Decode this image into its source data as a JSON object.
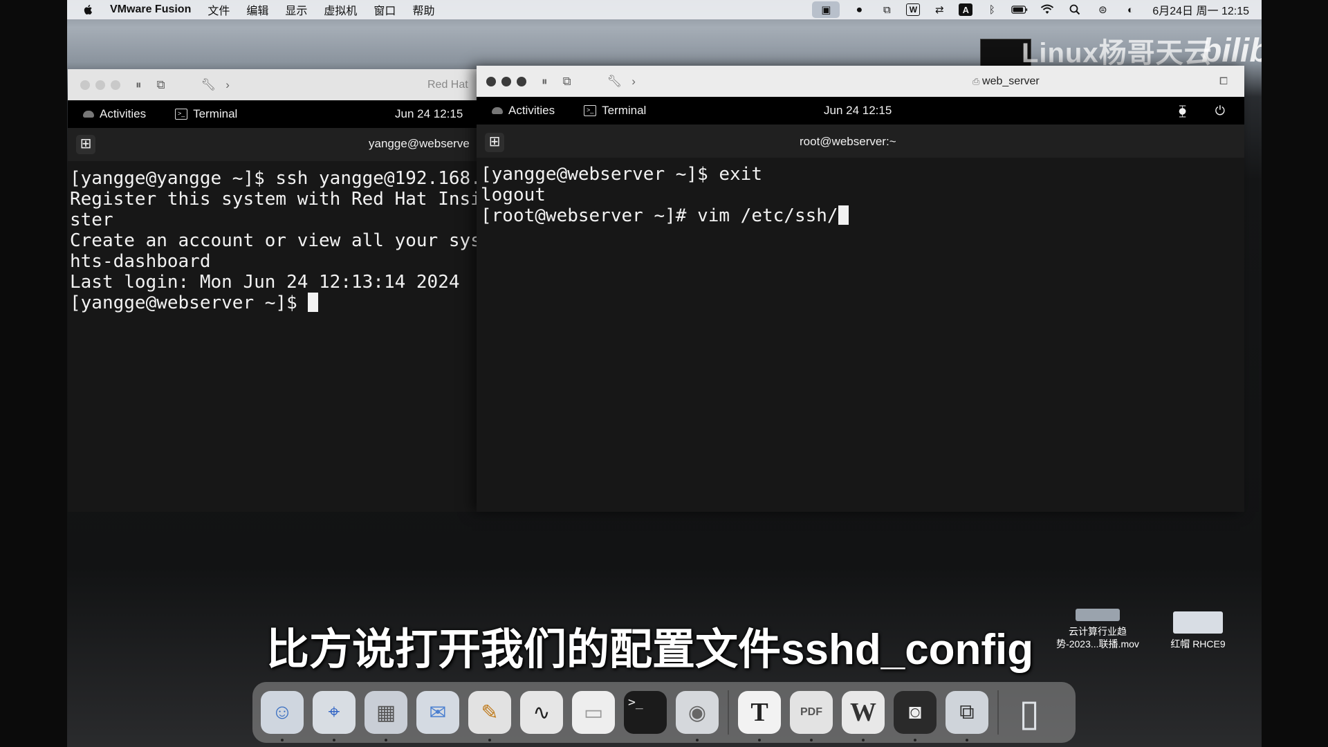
{
  "menubar": {
    "app_name": "VMware Fusion",
    "items": [
      "文件",
      "编辑",
      "显示",
      "虚拟机",
      "窗口",
      "帮助"
    ],
    "status_icons": [
      "vm-icon",
      "camera-icon",
      "screen-icon",
      "wps-icon",
      "sync-icon",
      "input-a-icon",
      "bluetooth-icon",
      "battery-icon",
      "wifi-icon",
      "search-icon",
      "control-center-icon",
      "siri-icon"
    ],
    "input_label": "A",
    "clock": "6月24日 周一  12:15"
  },
  "watermark": {
    "text": "Linux杨哥天云",
    "logo": "bilibili"
  },
  "left_window": {
    "title": "Red Hat",
    "gnome": {
      "activities": "Activities",
      "app": "Terminal",
      "clock": "Jun 24  12:15"
    },
    "term_title": "yangge@webserve",
    "lines": [
      "[yangge@yangge ~]$ ssh yangge@192.168.",
      "Register this system with Red Hat Insi",
      "ster",
      "Create an account or view all your sys",
      "hts-dashboard",
      "Last login: Mon Jun 24 12:13:14 2024"
    ],
    "prompt": "[yangge@webserver ~]$ "
  },
  "right_window": {
    "title": "web_server",
    "gnome": {
      "activities": "Activities",
      "app": "Terminal",
      "clock": "Jun 24  12:15"
    },
    "term_title": "root@webserver:~",
    "lines": [
      "[yangge@webserver ~]$ exit",
      "logout"
    ],
    "prompt": "[root@webserver ~]# vim /etc/ssh/"
  },
  "subtitle": "比方说打开我们的配置文件sshd_config",
  "desktop": [
    {
      "label_line1": "云计算行业趋",
      "label_line2": "势-2023...联播.mov"
    },
    {
      "label_line1": "红帽 RHCE9",
      "label_line2": ""
    }
  ],
  "dock": {
    "apps": [
      {
        "name": "Finder",
        "glyph": "☺",
        "bg": "#cfd6df",
        "color": "#3a6fc1",
        "dot": true
      },
      {
        "name": "Safari",
        "glyph": "⌖",
        "bg": "#d8dde3",
        "color": "#2e62c4",
        "dot": true
      },
      {
        "name": "Launchpad",
        "glyph": "▦",
        "bg": "#c9ced6",
        "color": "#555",
        "dot": true
      },
      {
        "name": "Mail",
        "glyph": "✉",
        "bg": "#d4dae2",
        "color": "#4a7fd0",
        "dot": false
      },
      {
        "name": "Pages",
        "glyph": "✎",
        "bg": "#e2e2e2",
        "color": "#c07b1b",
        "dot": true
      },
      {
        "name": "Freeform",
        "glyph": "∿",
        "bg": "#e6e6e6",
        "color": "#222",
        "dot": false
      },
      {
        "name": "Notes",
        "glyph": "▭",
        "bg": "#eeeeee",
        "color": "#999",
        "dot": false
      },
      {
        "name": "Terminal",
        "glyph": ">_",
        "bg": "#1b1b1b",
        "color": "#eee",
        "dot": false
      },
      {
        "name": "Chrome",
        "glyph": "◉",
        "bg": "#d5d8dc",
        "color": "#666",
        "dot": true
      },
      {
        "name": "Typora",
        "glyph": "T",
        "bg": "#f2f2f2",
        "color": "#222",
        "dot": true
      },
      {
        "name": "PDF Expert",
        "glyph": "PDF",
        "bg": "#e3e3e3",
        "color": "#555",
        "dot": true
      },
      {
        "name": "WPS",
        "glyph": "W",
        "bg": "#e8e8e8",
        "color": "#333",
        "dot": true
      },
      {
        "name": "ChatBot",
        "glyph": "◙",
        "bg": "#2a2a2a",
        "color": "#eee",
        "dot": true
      },
      {
        "name": "VMware Fusion",
        "glyph": "⧉",
        "bg": "#cfd4da",
        "color": "#333",
        "dot": true
      },
      {
        "name": "Trash",
        "glyph": "▯",
        "bg": "transparent",
        "color": "#dfe3e7",
        "dot": false
      }
    ]
  }
}
